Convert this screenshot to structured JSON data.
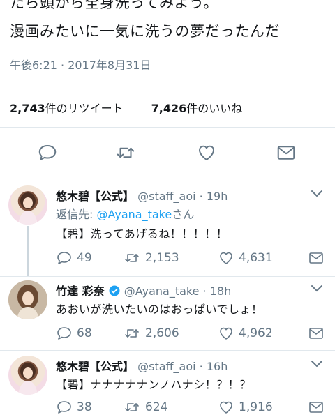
{
  "main_tweet": {
    "text_line1": "たら頭から全身洗ってみよう。",
    "text_line2": "漫画みたいに一気に洗うの夢だったんだ",
    "timestamp": "午後6:21 · 2017年8月31日",
    "retweet_count": "2,743",
    "retweet_label": "件のリツイート",
    "like_count": "7,426",
    "like_label": "件のいいね"
  },
  "replies": [
    {
      "name": "悠木碧【公式】",
      "handle_time": "@staff_aoi · 19h",
      "replying_prefix": "返信先: ",
      "replying_to": "@Ayana_take",
      "replying_suffix": "さん",
      "text": "【碧】洗ってあげるね！！！！！",
      "replies": "49",
      "retweets": "2,153",
      "likes": "4,631"
    },
    {
      "name": "竹達 彩奈",
      "handle_time": "@Ayana_take · 18h",
      "text": "あおいが洗いたいのはおっぱいでしょ！",
      "replies": "68",
      "retweets": "2,606",
      "likes": "4,962"
    },
    {
      "name": "悠木碧【公式】",
      "handle_time": "@staff_aoi · 16h",
      "text": "【碧】ナナナナナンノハナシ！？！？",
      "replies": "38",
      "retweets": "624",
      "likes": "1,916"
    }
  ],
  "icons": {
    "reply": "reply-icon",
    "retweet": "retweet-icon",
    "like": "heart-icon",
    "message": "envelope-icon",
    "verified": "verified-badge-icon",
    "more": "chevron-down-icon"
  },
  "colors": {
    "icon_gray": "#657786",
    "link_blue": "#1da1f2",
    "divider": "#e1e8ed"
  }
}
